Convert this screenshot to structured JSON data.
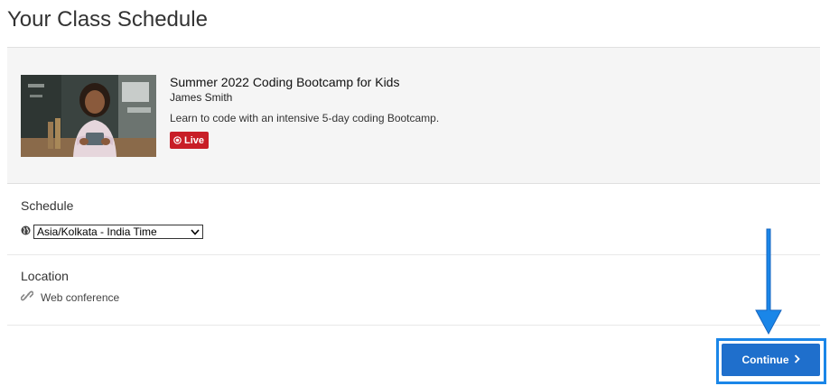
{
  "page": {
    "title": "Your Class Schedule"
  },
  "course": {
    "title": "Summer 2022 Coding Bootcamp for Kids",
    "instructor": "James Smith",
    "description": "Learn to code with an intensive 5-day coding Bootcamp.",
    "badge": "Live",
    "thumbnail_icon": "course-photo"
  },
  "schedule": {
    "label": "Schedule",
    "timezone_icon": "globe-icon",
    "timezone_selected": "Asia/Kolkata - India Time"
  },
  "location": {
    "label": "Location",
    "icon": "link-icon",
    "value": "Web conference"
  },
  "actions": {
    "continue_label": "Continue"
  },
  "colors": {
    "primary": "#1f6fcc",
    "highlight": "#1a86e8",
    "live": "#c81e27",
    "card_bg": "#f5f5f5"
  }
}
